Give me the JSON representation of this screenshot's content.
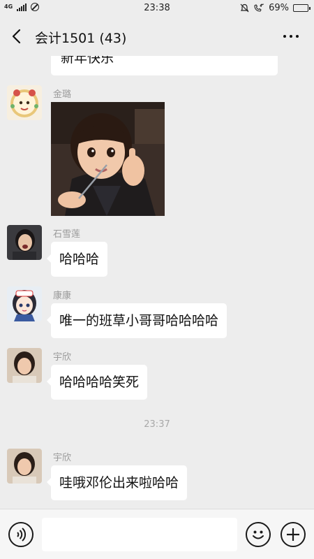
{
  "status_bar": {
    "network": "4G",
    "time": "23:38",
    "battery": "69%",
    "battery_level": 0.69
  },
  "header": {
    "title": "会计1501 (43)"
  },
  "messages": [
    {
      "type": "text",
      "text": "新年快乐"
    },
    {
      "type": "image",
      "sender": "金璐",
      "image_alt": "child-thumbs-up-photo"
    },
    {
      "type": "text",
      "sender": "石雪莲",
      "text": "哈哈哈"
    },
    {
      "type": "text",
      "sender": "康康",
      "text": "唯一的班草小哥哥哈哈哈哈"
    },
    {
      "type": "text",
      "sender": "宇欣",
      "text": "哈哈哈哈笑死"
    },
    {
      "type": "time",
      "text": "23:37"
    },
    {
      "type": "text",
      "sender": "宇欣",
      "text": "哇哦邓伦出来啦哈哈"
    }
  ],
  "input": {
    "value": "",
    "placeholder": ""
  },
  "colors": {
    "background": "#ededed",
    "bubble": "#ffffff",
    "sender_name": "#9a9a9a"
  }
}
